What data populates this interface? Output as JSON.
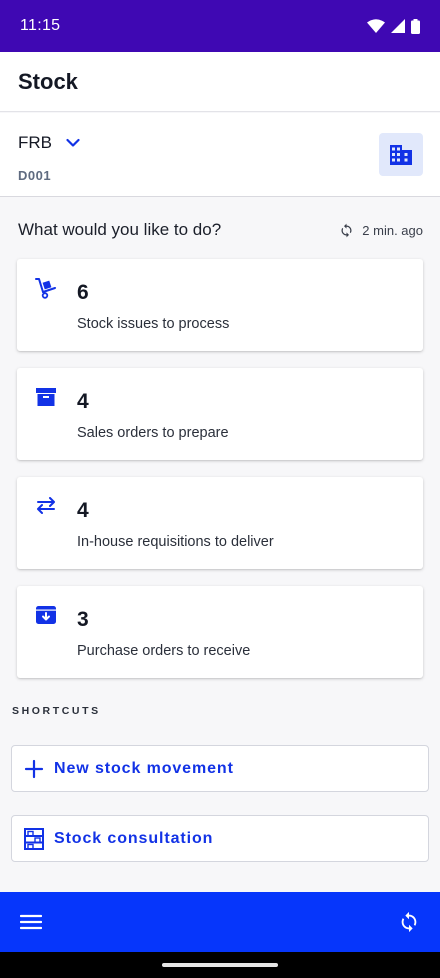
{
  "status_bar": {
    "time": "11:15"
  },
  "header": {
    "title": "Stock"
  },
  "site": {
    "name": "FRB",
    "code": "D001"
  },
  "dashboard": {
    "question": "What would you like to do?",
    "last_refresh": "2 min. ago",
    "tasks": [
      {
        "count": "6",
        "label": "Stock issues to process",
        "icon": "hand-truck-icon"
      },
      {
        "count": "4",
        "label": "Sales orders to prepare",
        "icon": "archive-box-icon"
      },
      {
        "count": "4",
        "label": "In-house requisitions to deliver",
        "icon": "swap-arrows-icon"
      },
      {
        "count": "3",
        "label": "Purchase orders to receive",
        "icon": "inbox-receive-icon"
      }
    ]
  },
  "shortcuts": {
    "title": "SHORTCUTS",
    "items": [
      {
        "label": "New stock movement",
        "icon": "plus-icon"
      },
      {
        "label": "Stock consultation",
        "icon": "shelving-icon"
      }
    ]
  },
  "colors": {
    "status_bar": "#3f08b3",
    "accent": "#1232e6",
    "bottom_bar": "#0636fb",
    "site_button_bg": "#e1e8fb"
  }
}
